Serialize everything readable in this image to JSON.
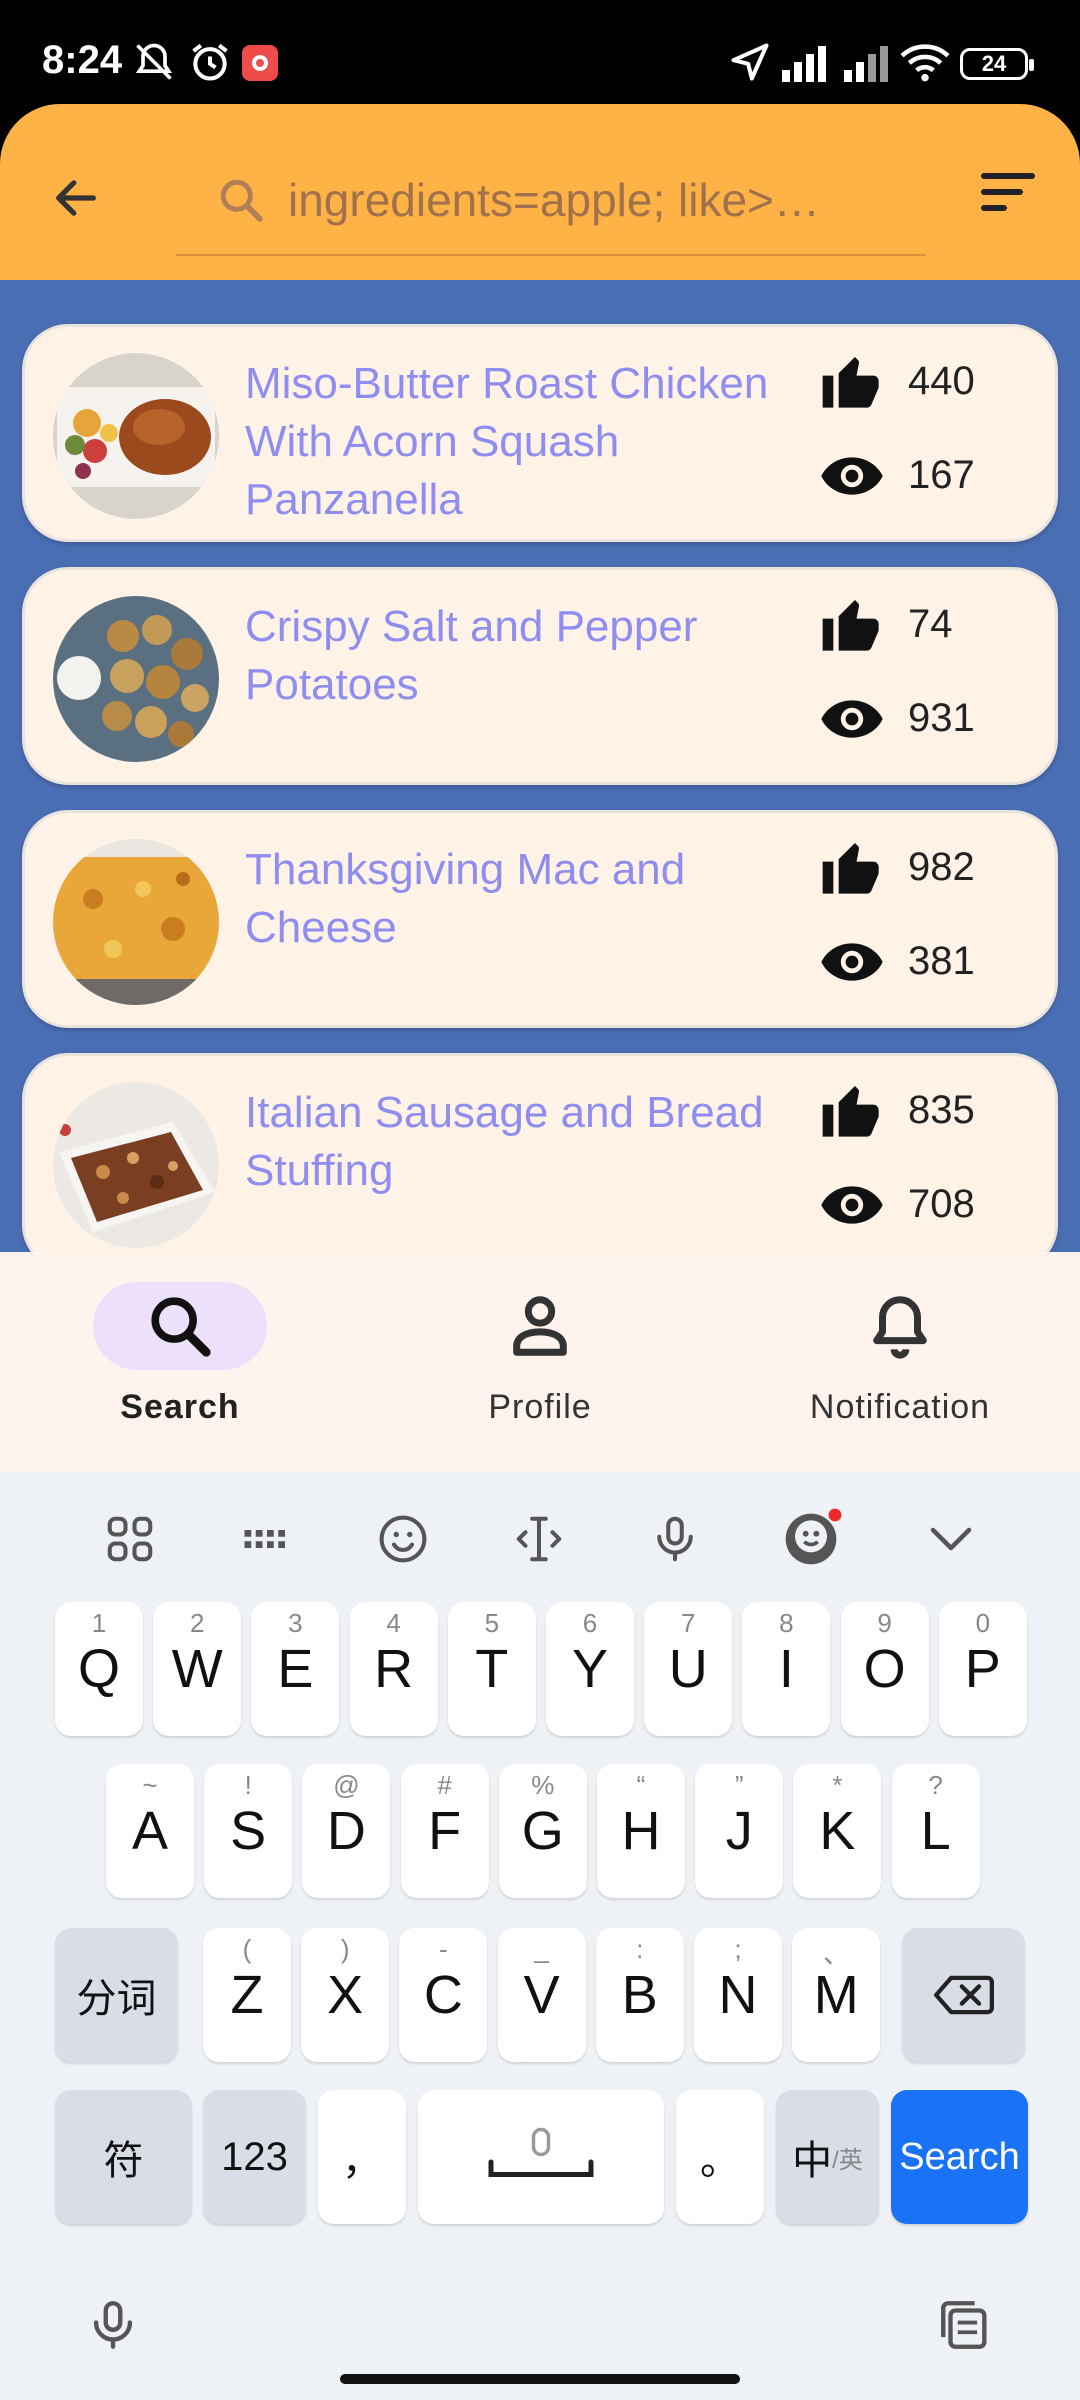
{
  "status_bar": {
    "time": "8:24",
    "battery": "24",
    "icons": [
      "muted-bell-icon",
      "alarm-icon",
      "screen-record-icon",
      "location-icon",
      "signal-icon",
      "hd-signal-icon",
      "wifi-icon",
      "battery-icon"
    ]
  },
  "header": {
    "back_icon": "arrow-left-icon",
    "search_value": "ingredients=apple; like>…",
    "filter_icon": "sort-icon",
    "accent_color": "#ffb347"
  },
  "list_bg_color": "#4a6eb4",
  "recipes": [
    {
      "title": "Miso-Butter Roast Chicken With Acorn Squash Panzanella",
      "likes": "440",
      "views": "167"
    },
    {
      "title": "Crispy Salt and Pepper Potatoes",
      "likes": "74",
      "views": "931"
    },
    {
      "title": "Thanksgiving Mac and Cheese",
      "likes": "982",
      "views": "381"
    },
    {
      "title": "Italian Sausage and Bread Stuffing",
      "likes": "835",
      "views": "708"
    }
  ],
  "bottom_nav": [
    {
      "label": "Search",
      "icon": "search-icon",
      "active": true
    },
    {
      "label": "Profile",
      "icon": "person-icon",
      "active": false
    },
    {
      "label": "Notification",
      "icon": "bell-icon",
      "active": false
    }
  ],
  "keyboard": {
    "row1": [
      {
        "k": "Q",
        "h": "1"
      },
      {
        "k": "W",
        "h": "2"
      },
      {
        "k": "E",
        "h": "3"
      },
      {
        "k": "R",
        "h": "4"
      },
      {
        "k": "T",
        "h": "5"
      },
      {
        "k": "Y",
        "h": "6"
      },
      {
        "k": "U",
        "h": "7"
      },
      {
        "k": "I",
        "h": "8"
      },
      {
        "k": "O",
        "h": "9"
      },
      {
        "k": "P",
        "h": "0"
      }
    ],
    "row2": [
      {
        "k": "A",
        "h": "~"
      },
      {
        "k": "S",
        "h": "!"
      },
      {
        "k": "D",
        "h": "@"
      },
      {
        "k": "F",
        "h": "#"
      },
      {
        "k": "G",
        "h": "%"
      },
      {
        "k": "H",
        "h": "“"
      },
      {
        "k": "J",
        "h": "”"
      },
      {
        "k": "K",
        "h": "*"
      },
      {
        "k": "L",
        "h": "?"
      }
    ],
    "row3": [
      {
        "k": "Z",
        "h": "("
      },
      {
        "k": "X",
        "h": ")"
      },
      {
        "k": "C",
        "h": "-"
      },
      {
        "k": "V",
        "h": "_"
      },
      {
        "k": "B",
        "h": ":"
      },
      {
        "k": "N",
        "h": ";"
      },
      {
        "k": "M",
        "h": "、"
      }
    ],
    "segment_label": "分词",
    "symbols_label": "符",
    "numbers_label": "123",
    "comma_label": "，",
    "period_label": "。",
    "lang_label": "中",
    "lang_sub": "/英",
    "search_label": "Search",
    "search_color": "#1a73f6"
  }
}
